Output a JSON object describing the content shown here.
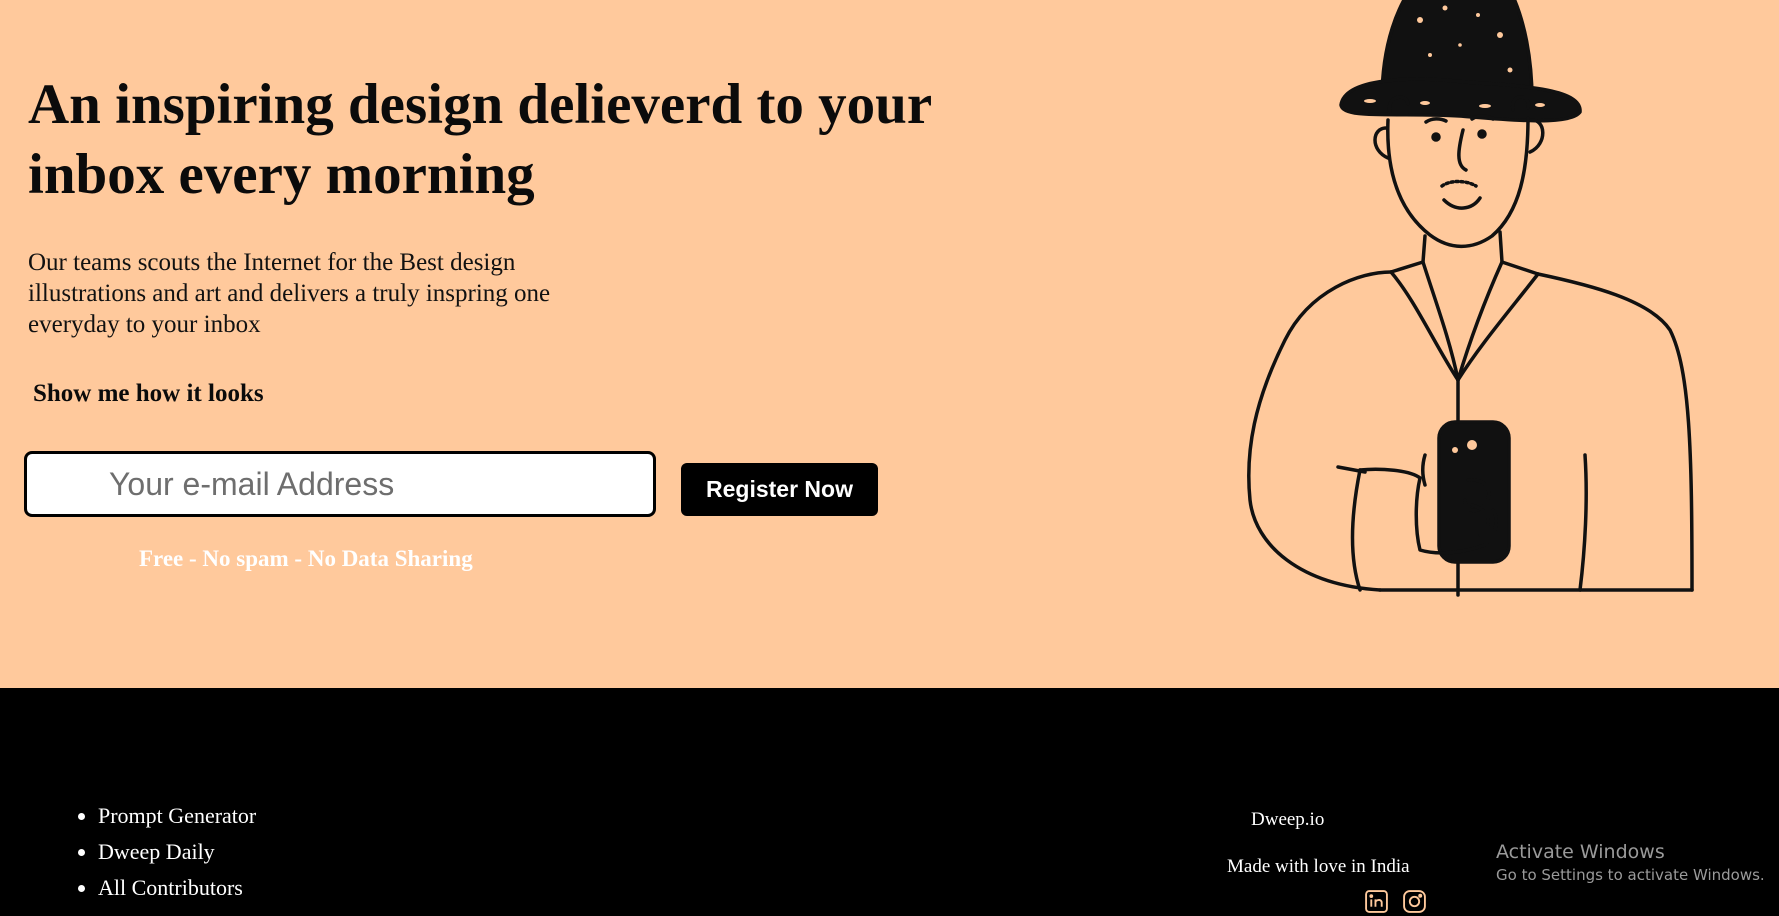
{
  "hero": {
    "headline": "An inspiring design delieverd to your inbox every morning",
    "subtext": "Our teams scouts the Internet for the Best design illustrations and art and delivers a truly inspring one everyday to your inbox",
    "show_link": "Show me how it looks",
    "email_placeholder": "Your e-mail Address",
    "register_label": "Register Now",
    "free_note": "Free - No spam - No Data Sharing",
    "background_color": "#ffc99c"
  },
  "footer": {
    "links": [
      "Prompt Generator",
      "Dweep Daily",
      "All Contributors"
    ],
    "brand": "Dweep.io",
    "made_with": "Made with love in India",
    "social_icons": [
      "linkedin-icon",
      "instagram-icon"
    ],
    "icon_color": "#ffc99c"
  },
  "os_overlay": {
    "title": "Activate Windows",
    "subtitle": "Go to Settings to activate Windows."
  }
}
